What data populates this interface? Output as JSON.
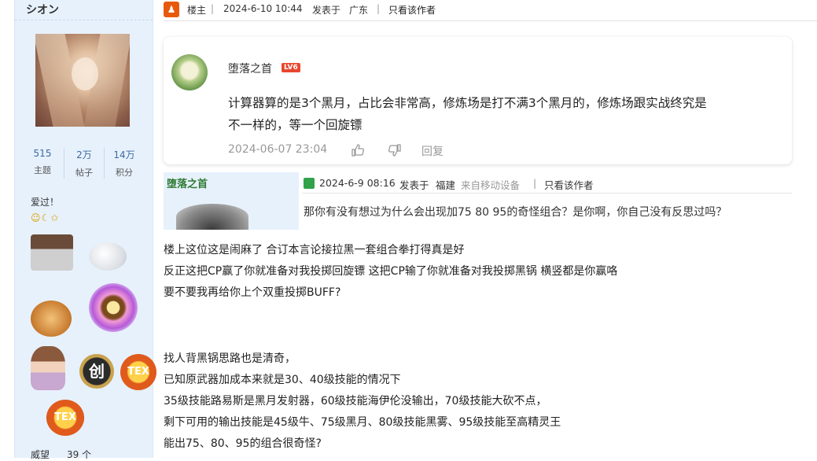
{
  "sidebar": {
    "username": "シオン",
    "stats": [
      {
        "value": "515",
        "label": "主题"
      },
      {
        "value": "2万",
        "label": "帖子"
      },
      {
        "value": "14万",
        "label": "积分"
      }
    ],
    "signature": "爱过！",
    "smileys": "☺☾✩",
    "prestige_label": "威望",
    "prestige_value": "39 个",
    "medals": [
      "creator-medal",
      "tex-medal"
    ],
    "medal_text": {
      "chuang": "创",
      "tex": "TEX"
    }
  },
  "post_header": {
    "role": "楼主",
    "time": "2024-6-10 10:44",
    "posted_in": "发表于",
    "location": "广东",
    "only_author": "只看该作者"
  },
  "embedded_reply": {
    "name": "堕落之首",
    "level": "LV6",
    "text_line1": "计算器算的是3个黑月，占比会非常高，修炼场是打不满3个黑月的，修炼场跟实战终究是",
    "text_line2": "不一样的，等一个回旋镖",
    "date": "2024-06-07 23:04",
    "reply": "回复"
  },
  "quoted_post": {
    "name": "堕落之首",
    "time": "2024-6-9 08:16",
    "posted_in": "发表于",
    "location": "福建",
    "device": "来自移动设备",
    "only_author": "只看该作者",
    "text": "那你有没有想过为什么会出现加75 80 95的奇怪组合？是你啊，你自己没有反思过吗？"
  },
  "body": {
    "lines": [
      "楼上这位这是闹麻了 合订本言论接拉黑一套组合拳打得真是好",
      "反正这把CP赢了你就准备对我投掷回旋镖 这把CP输了你就准备对我投掷黑锅 横竖都是你赢咯",
      "要不要我再给你上个双重投掷BUFF?",
      "找人背黑锅思路也是清奇，",
      "已知原武器加成本来就是30、40级技能的情况下",
      "35级技能路易斯是黑月发射器，60级技能海伊伦没输出，70级技能大砍不点，",
      "剩下可用的输出技能是45级牛、75级黑月、80级技能黑雾、95级技能至高精灵王",
      "能出75、80、95的组合很奇怪?"
    ]
  },
  "colors": {
    "sidebar_bg": "#e7f1fc",
    "quote_name": "#2e7a32",
    "level_badge": "#e8462f",
    "owner_icon": "#e8590c"
  }
}
